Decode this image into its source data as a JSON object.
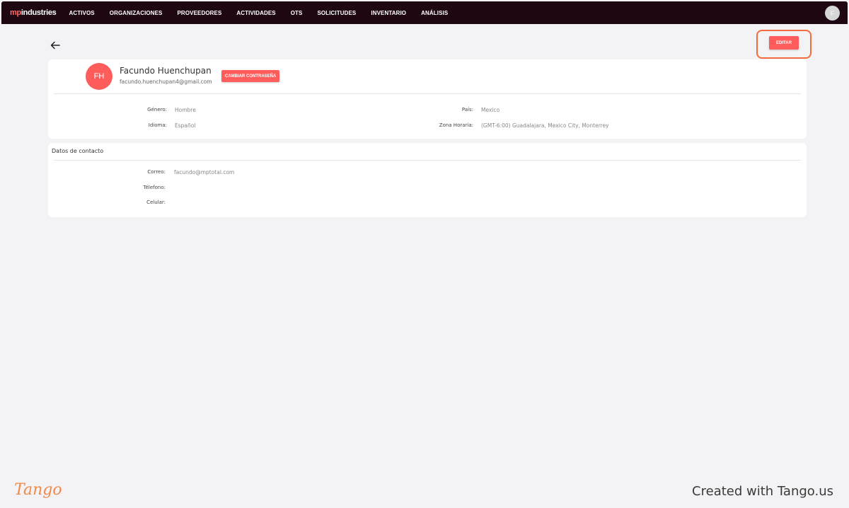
{
  "navbar": {
    "logo_mp": "mp",
    "logo_industries": "industries",
    "items": [
      {
        "label": "ACTIVOS"
      },
      {
        "label": "ORGANIZACIONES"
      },
      {
        "label": "PROVEEDORES"
      },
      {
        "label": "ACTIVIDADES"
      },
      {
        "label": "OTS"
      },
      {
        "label": "SOLICITUDES"
      },
      {
        "label": "INVENTARIO"
      },
      {
        "label": "ANÁLISIS"
      }
    ],
    "avatar_initial": "F"
  },
  "toolbar": {
    "back_icon": "arrow-left-icon",
    "edit_label": "EDITAR"
  },
  "profile": {
    "initials": "FH",
    "name": "Facundo Huenchupan",
    "email": "facundo.huenchupan4@gmail.com",
    "change_password_label": "CAMBIAR CONTRASEÑA",
    "fields": {
      "gender_label": "Género:",
      "gender_value": "Hombre",
      "language_label": "Idioma:",
      "language_value": "Español",
      "country_label": "País:",
      "country_value": "Mexico",
      "timezone_label": "Zona Horaria:",
      "timezone_value": "(GMT-6:00) Guadalajara, Mexico City, Monterrey"
    }
  },
  "contact": {
    "title": "Datos de contacto",
    "email_label": "Correo:",
    "email_value": "facundo@mptotal.com",
    "phone_label": "Télefono:",
    "phone_value": "",
    "mobile_label": "Celular:",
    "mobile_value": ""
  },
  "footer": {
    "brand": "Tango",
    "created": "Created with Tango.us"
  },
  "colors": {
    "navbar_bg": "#1e0713",
    "accent": "#ff5c5c",
    "highlight": "#f26c3d",
    "page_bg": "#f3f2f4"
  }
}
